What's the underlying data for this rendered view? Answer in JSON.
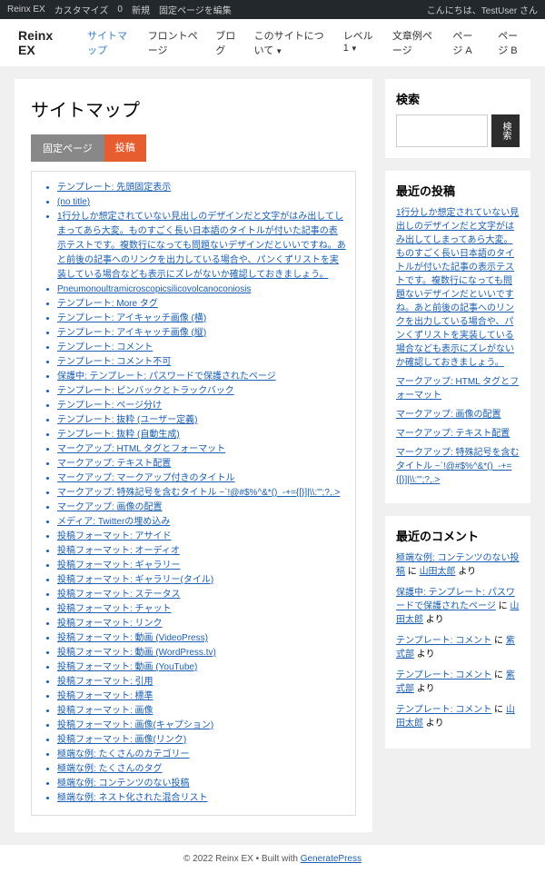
{
  "admin_bar": {
    "left": [
      "Reinx EX",
      "カスタマイズ",
      "0",
      "新規",
      "固定ページを編集"
    ],
    "right": "こんにちは、TestUser さん"
  },
  "header": {
    "site_title": "Reinx EX",
    "nav": [
      {
        "label": "サイトマップ",
        "active": true
      },
      {
        "label": "フロントページ"
      },
      {
        "label": "ブログ"
      },
      {
        "label": "このサイトについて",
        "dropdown": true
      },
      {
        "label": "レベル1",
        "dropdown": true
      },
      {
        "label": "文章例ページ"
      },
      {
        "label": "ページ A"
      },
      {
        "label": "ページ B"
      }
    ]
  },
  "main": {
    "title": "サイトマップ",
    "tabs": [
      {
        "label": "固定ページ",
        "active": true
      },
      {
        "label": "投稿",
        "secondary": true
      }
    ],
    "posts": [
      "テンプレート: 先頭固定表示",
      "(no title)",
      "1行分しか想定されていない見出しのデザインだと文字がはみ出してしまってあら大変。ものすごく長い日本語のタイトルが付いた記事の表示テストです。複数行になっても問題ないデザインだといいですね。あと前後の記事へのリンクを出力している場合や、パンくずリストを実装している場合なども表示にズレがないか確認しておきましょう。",
      "Pneumonoultramicroscopicsilicovolcanoconiosis",
      "テンプレート: More タグ",
      "テンプレート: アイキャッチ画像 (横)",
      "テンプレート: アイキャッチ画像 (縦)",
      "テンプレート: コメント",
      "テンプレート: コメント不可",
      "保護中: テンプレート: パスワードで保護されたページ",
      "テンプレート: ピンバックとトラックバック",
      "テンプレート: ページ分け",
      "テンプレート: 抜粋 (ユーザー定義)",
      "テンプレート: 抜粋 (自動生成)",
      "マークアップ: HTML タグとフォーマット",
      "マークアップ: テキスト配置",
      "マークアップ: マークアップ付きのタイトル",
      "マークアップ: 特殊記号を含むタイトル ~`!@#$%^&*()_-+={[}]|\\\\:\"';?,.>",
      "マークアップ: 画像の配置",
      "メディア: Twitterの埋め込み",
      "投稿フォーマット: アサイド",
      "投稿フォーマット: オーディオ",
      "投稿フォーマット: ギャラリー",
      "投稿フォーマット: ギャラリー(タイル)",
      "投稿フォーマット: ステータス",
      "投稿フォーマット: チャット",
      "投稿フォーマット: リンク",
      "投稿フォーマット: 動画 (VideoPress)",
      "投稿フォーマット: 動画 (WordPress.tv)",
      "投稿フォーマット: 動画 (YouTube)",
      "投稿フォーマット: 引用",
      "投稿フォーマット: 標準",
      "投稿フォーマット: 画像",
      "投稿フォーマット: 画像(キャプション)",
      "投稿フォーマット: 画像(リンク)",
      "極端な例: たくさんのカテゴリー",
      "極端な例: たくさんのタグ",
      "極端な例: コンテンツのない投稿",
      "極端な例: ネスト化された混合リスト"
    ]
  },
  "sidebar": {
    "search": {
      "title": "検索",
      "button": "検索"
    },
    "recent_posts": {
      "title": "最近の投稿",
      "items": [
        "1行分しか想定されていない見出しのデザインだと文字がはみ出してしまってあら大変。ものすごく長い日本語のタイトルが付いた記事の表示テストです。複数行になっても問題ないデザインだといいですね。あと前後の記事へのリンクを出力している場合や、パンくずリストを実装している場合なども表示にズレがないか確認しておきましょう。",
        "マークアップ: HTML タグとフォーマット",
        "マークアップ: 画像の配置",
        "マークアップ: テキスト配置",
        "マークアップ: 特殊記号を含むタイトル ~`!@#$%^&*()_-+={[}]|\\\\:\"';?,.>"
      ]
    },
    "recent_comments": {
      "title": "最近のコメント",
      "items": [
        {
          "post": "極端な例: コンテンツのない投稿",
          "sep": " に ",
          "author": "山田太郎",
          "suffix": " より"
        },
        {
          "post": "保護中: テンプレート: パスワードで保護されたページ",
          "sep": " に ",
          "author": "山田太郎",
          "suffix": " より"
        },
        {
          "post": "テンプレート: コメント",
          "sep": " に ",
          "author": "紫式部",
          "suffix": " より"
        },
        {
          "post": "テンプレート: コメント",
          "sep": " に ",
          "author": "紫式部",
          "suffix": " より"
        },
        {
          "post": "テンプレート: コメント",
          "sep": " に ",
          "author": "山田太郎",
          "suffix": " より"
        }
      ]
    }
  },
  "footer": {
    "prefix": "© 2022 Reinx EX • Built with ",
    "link": "GeneratePress"
  }
}
